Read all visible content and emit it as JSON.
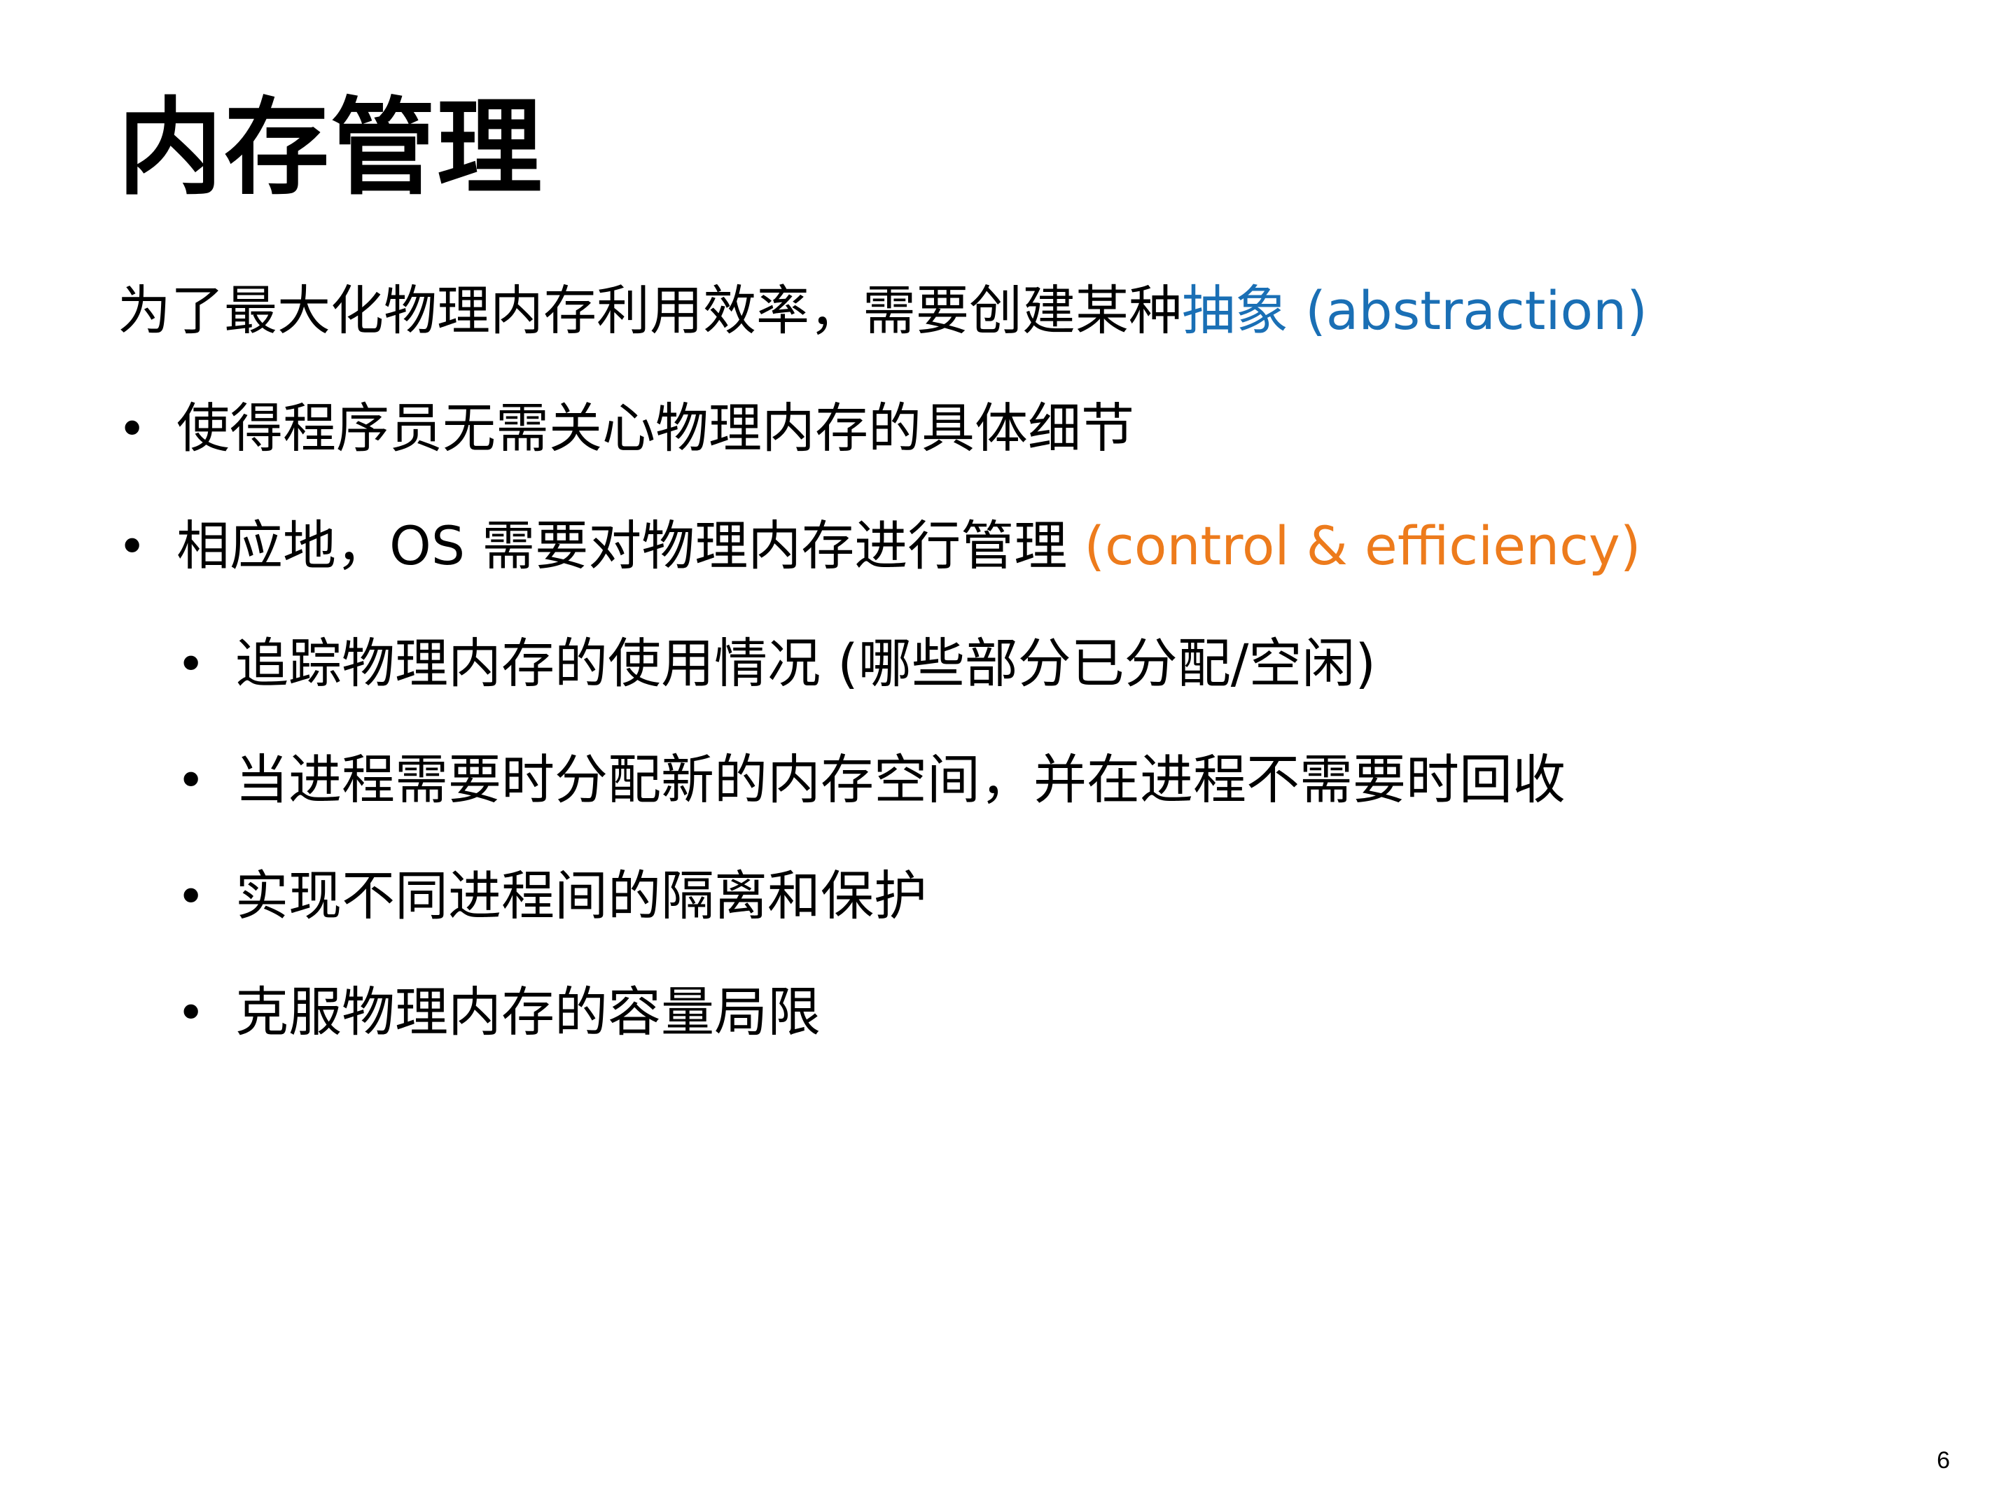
{
  "slide": {
    "title": "内存管理",
    "lead": {
      "text": "为了最大化物理内存利用效率，需要创建某种",
      "highlight": "抽象 (abstraction)"
    },
    "bullets": [
      {
        "level": 1,
        "text": "使得程序员无需关心物理内存的具体细节",
        "highlight": ""
      },
      {
        "level": 1,
        "text": "相应地，OS 需要对物理内存进行管理 ",
        "highlight": "(control & efficiency)"
      },
      {
        "level": 2,
        "text": "追踪物理内存的使用情况 (哪些部分已分配/空闲)",
        "highlight": ""
      },
      {
        "level": 2,
        "text": "当进程需要时分配新的内存空间，并在进程不需要时回收",
        "highlight": ""
      },
      {
        "level": 2,
        "text": "实现不同进程间的隔离和保护",
        "highlight": ""
      },
      {
        "level": 2,
        "text": "克服物理内存的容量局限",
        "highlight": ""
      }
    ],
    "bullet_glyph": "•",
    "page_number": "6"
  },
  "colors": {
    "accent_blue": "#1a6fb5",
    "accent_orange": "#ed7b1c",
    "text": "#000000",
    "background": "#ffffff"
  }
}
